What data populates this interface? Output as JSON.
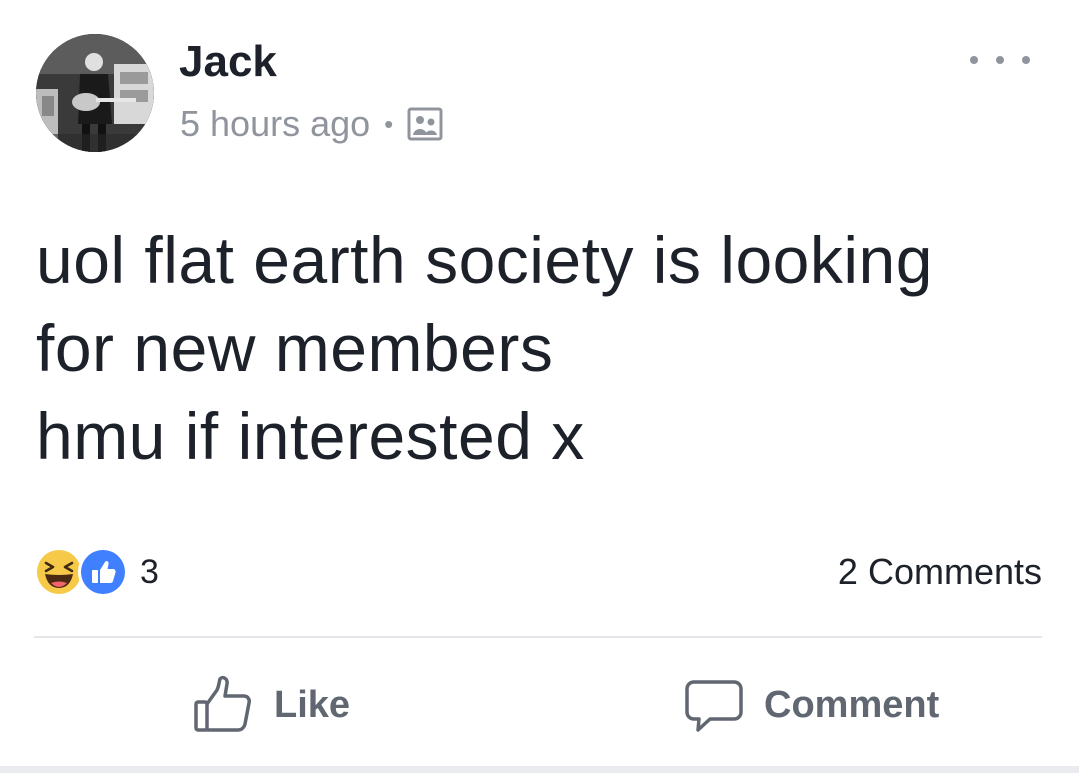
{
  "post": {
    "author": {
      "name": "Jack",
      "avatar_icon": "user-avatar-guitar-photo"
    },
    "timestamp": "5 hours ago",
    "separator": "•",
    "audience_icon": "custom-audience-icon",
    "more_icon": "more-options-icon",
    "text": "uol flat earth society is looking\nfor new members\nhmu if interested x",
    "reactions": {
      "icons": [
        "haha-reaction-icon",
        "like-reaction-icon"
      ],
      "count": "3"
    },
    "comments_count": "2 Comments",
    "actions": {
      "like_label": "Like",
      "comment_label": "Comment"
    }
  },
  "colors": {
    "text_primary": "#1d2129",
    "text_secondary": "#90949c",
    "action_gray": "#606770",
    "like_blue": "#4080ff",
    "haha_yellow": "#f7c948",
    "divider": "#e5e6e9"
  }
}
